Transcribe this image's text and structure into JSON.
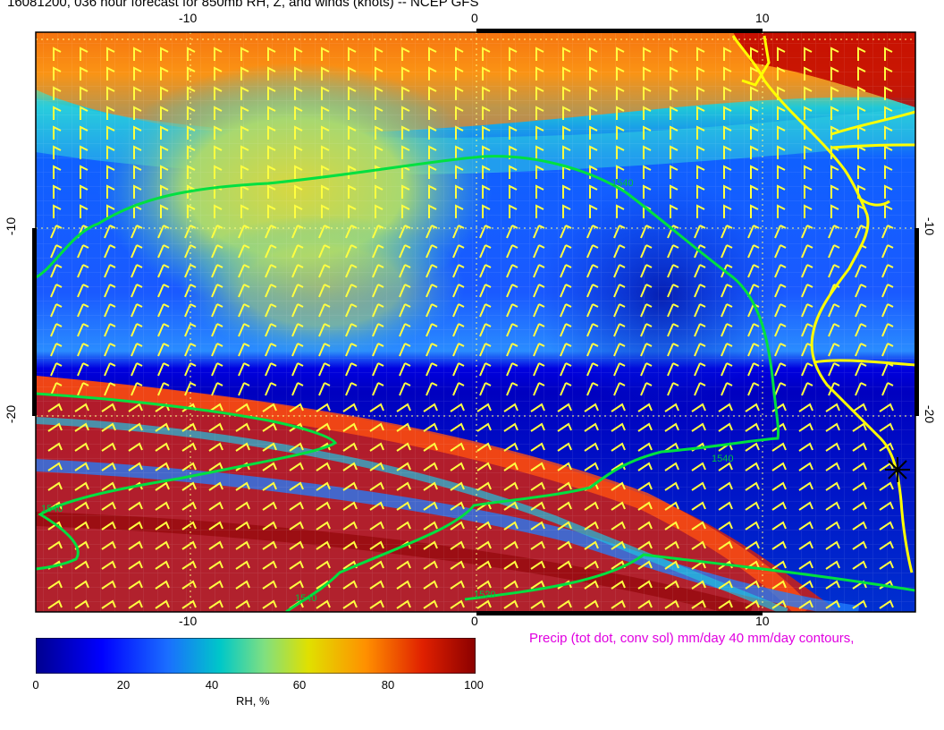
{
  "header": {
    "title": "16081200, 036 hour forecast for 850mb RH, Z, and winds (knots)  -- NCEP GFS"
  },
  "map": {
    "projection_note": "lat/lon grid",
    "lon_ticks": [
      "-10",
      "0",
      "10"
    ],
    "lat_ticks": [
      "-10",
      "-20"
    ],
    "contour_labels": [
      "1540",
      "1540",
      "1540",
      "1540",
      "1520"
    ],
    "coast_color": "#ffff00",
    "contour_color": "#00e040",
    "barb_color": "#ffff40"
  },
  "legend": {
    "precip_text": "Precip (tot dot, conv sol) mm/day 40 mm/day contours,",
    "colorbar_labels": [
      "0",
      "20",
      "40",
      "60",
      "80",
      "100"
    ],
    "colorbar_title": "RH, %",
    "colors": [
      "#00008f",
      "#0000ff",
      "#1a6eff",
      "#00c8c8",
      "#80e080",
      "#e0e000",
      "#ff9000",
      "#e02000",
      "#8b0000"
    ]
  }
}
